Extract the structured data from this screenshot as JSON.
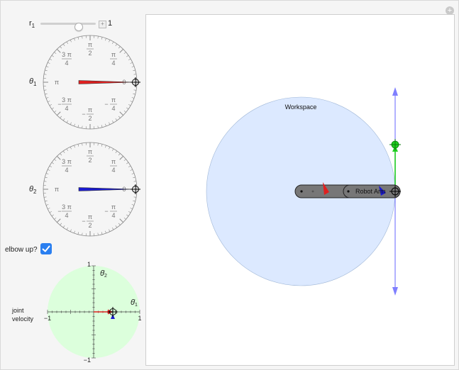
{
  "controls": {
    "r1": {
      "label": "r",
      "sub": "1",
      "value": "1",
      "fraction": 0.5
    },
    "theta1": {
      "label": "θ",
      "sub": "1"
    },
    "theta2": {
      "label": "θ",
      "sub": "2"
    },
    "elbow": {
      "label": "elbow up?",
      "checked": true
    },
    "joint_velocity": {
      "line1": "joint",
      "line2": "velocity"
    }
  },
  "dial": {
    "top_label": "π/2",
    "left_label": "π",
    "upper_left": "3 π/4",
    "upper_right": "π/4",
    "lower_left": "− 3 π/4",
    "lower_right": "− π/4",
    "bottom_label": "− π/2",
    "zero": "0",
    "pi_num": "π",
    "two": "2",
    "four": "4",
    "three_pi": "3 π",
    "minus": "−"
  },
  "velocity_pad": {
    "tick_top": "1",
    "tick_bottom": "−1",
    "tick_left": "−1",
    "tick_right": "1",
    "y_axis": "θ̇",
    "y_sub": "2",
    "x_axis": "θ̇",
    "x_sub": "1"
  },
  "workspace": {
    "title": "Workspace",
    "arm_label": "Robot Arm"
  },
  "colors": {
    "theta1_needle": "#e02020",
    "theta2_needle": "#1a1ad0",
    "workspace_fill": "#dce9ff",
    "velocity_pad": "#dcffdc",
    "end_effector": "#20d020",
    "axis_arrow": "#7f7fff"
  }
}
